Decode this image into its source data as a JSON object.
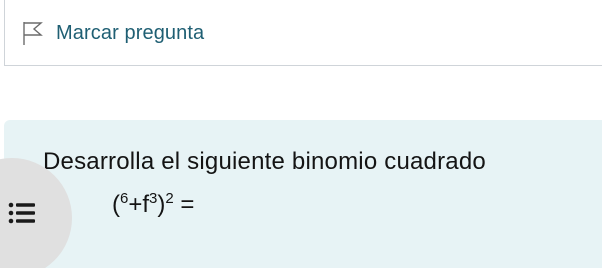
{
  "flag": {
    "label": "Marcar pregunta",
    "icon": "flag-icon"
  },
  "question": {
    "text": "Desarrolla el siguiente binomio cuadrado",
    "expression": {
      "prefix": "(",
      "exp1": "6",
      "plus_term": "+f",
      "exp2": "3",
      "close": ")",
      "exp3": "2",
      "equals": " ="
    }
  },
  "menu": {
    "icon": "list-menu-icon"
  },
  "colors": {
    "accent_text": "#1f5f73",
    "question_bg": "#e7f3f5",
    "fab_bg": "#e0e0e0",
    "border": "#cfd4d9"
  }
}
